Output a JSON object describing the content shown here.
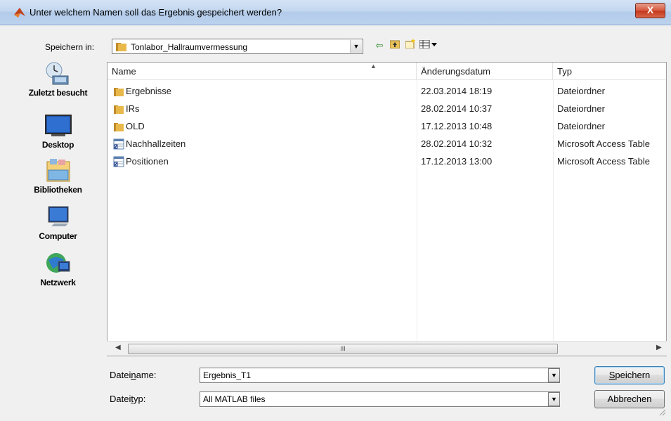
{
  "window": {
    "title": "Unter welchem Namen soll das Ergebnis gespeichert werden?",
    "close_label": "X"
  },
  "look_in": {
    "label": "Speichern in:",
    "value": "Tonlabor_Hallraumvermessung"
  },
  "toolbar": {
    "back_icon": "back-arrow-icon",
    "up_icon": "up-folder-icon",
    "new_folder_icon": "new-folder-icon",
    "view_icon": "view-menu-icon"
  },
  "places": [
    {
      "label": "Zuletzt besucht",
      "icon": "recent-places-icon"
    },
    {
      "label": "Desktop",
      "icon": "desktop-icon"
    },
    {
      "label": "Bibliotheken",
      "icon": "libraries-icon"
    },
    {
      "label": "Computer",
      "icon": "computer-icon"
    },
    {
      "label": "Netzwerk",
      "icon": "network-icon"
    }
  ],
  "file_list": {
    "columns": [
      "Name",
      "Änderungsdatum",
      "Typ"
    ],
    "rows": [
      {
        "name": "Ergebnisse",
        "date": "22.03.2014 18:19",
        "type": "Dateiordner",
        "icon": "folder-icon"
      },
      {
        "name": "IRs",
        "date": "28.02.2014 10:37",
        "type": "Dateiordner",
        "icon": "folder-icon"
      },
      {
        "name": "OLD",
        "date": "17.12.2013 10:48",
        "type": "Dateiordner",
        "icon": "folder-icon"
      },
      {
        "name": "Nachhallzeiten",
        "date": "28.02.2014 10:32",
        "type": "Microsoft Access Table",
        "icon": "access-table-icon"
      },
      {
        "name": "Positionen",
        "date": "17.12.2013 13:00",
        "type": "Microsoft Access Table",
        "icon": "access-table-icon"
      }
    ]
  },
  "filename": {
    "label_pre": "Datei",
    "label_u": "n",
    "label_post": "ame:",
    "value": "Ergebnis_T1"
  },
  "filetype": {
    "label_pre": "Datei",
    "label_u": "t",
    "label_post": "yp:",
    "value": "All MATLAB files"
  },
  "buttons": {
    "save_u": "S",
    "save_rest": "peichern",
    "cancel": "Abbrechen"
  },
  "colors": {
    "titlebar": "#c3d7ef",
    "close_button": "#c5381c",
    "folder": "#e8b84a"
  }
}
